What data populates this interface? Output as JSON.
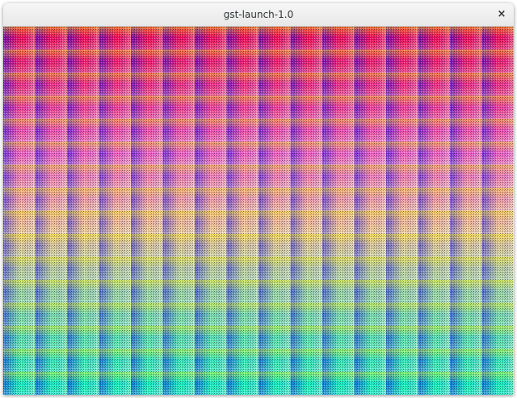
{
  "window": {
    "title": "gst-launch-1.0",
    "close_label": "×",
    "close_icon": "close-icon"
  },
  "video": {
    "pattern": "ball-grid-dither",
    "columns": 16,
    "rows": 16,
    "colors": {
      "top_left": "#ff0000",
      "top_right": "#ff0000",
      "bottom_left": "#00ffaa",
      "bottom_right": "#00ffaa",
      "column_tint": "#0000ff",
      "row_tint": "#ffff00",
      "dither_dot": "#000000"
    }
  }
}
